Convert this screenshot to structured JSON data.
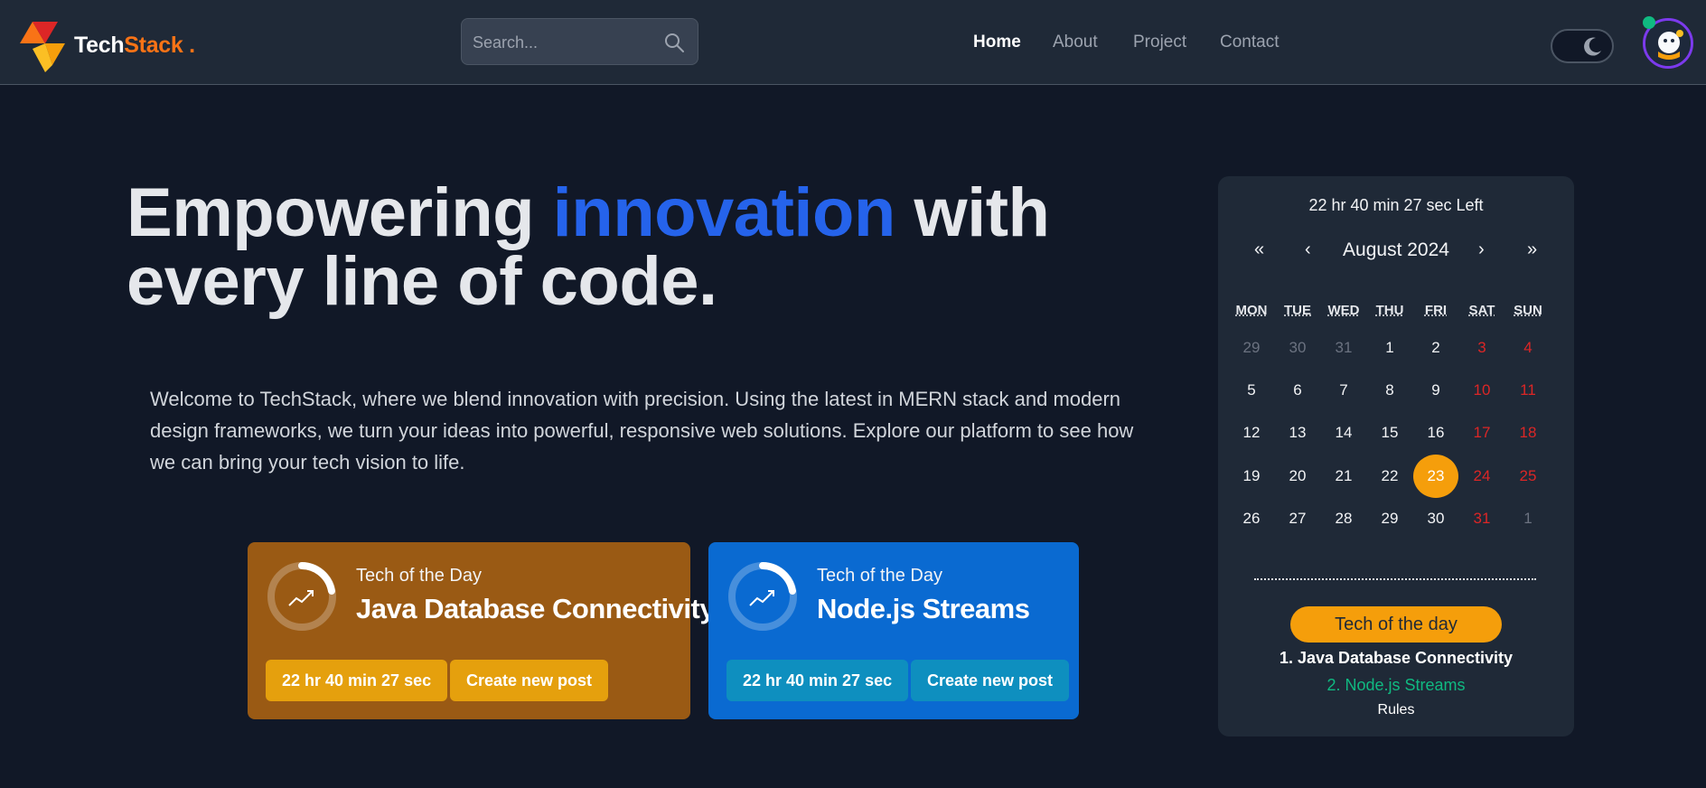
{
  "brand": {
    "name_a": "Tech",
    "name_b": "Stack",
    "name_c": " ."
  },
  "search": {
    "placeholder": "Search..."
  },
  "nav": [
    {
      "label": "Home",
      "active": true
    },
    {
      "label": "About",
      "active": false
    },
    {
      "label": "Project",
      "active": false
    },
    {
      "label": "Contact",
      "active": false
    }
  ],
  "hero": {
    "title_a": "Empowering ",
    "title_highlight": "innovation",
    "title_b": " with every line of code.",
    "text": "Welcome to TechStack, where we blend innovation with precision. Using the latest in MERN stack and modern design frameworks, we turn your ideas into powerful, responsive web solutions. Explore our platform to see how we can bring your tech vision to life."
  },
  "cards": [
    {
      "label": "Tech of the Day",
      "title": "Java Database Connectivity",
      "timer": "22 hr 40 min 27 sec",
      "action": "Create new post",
      "color": "#9a5a14"
    },
    {
      "label": "Tech of the Day",
      "title": "Node.js Streams",
      "timer": "22 hr 40 min 27 sec",
      "action": "Create new post",
      "color": "#0a6ad1"
    }
  ],
  "calendar": {
    "countdown": "22 hr 40 min 27 sec Left",
    "nav_first": "«",
    "nav_prev": "‹",
    "month": "August 2024",
    "nav_next": "›",
    "nav_last": "»",
    "weekdays": [
      "MON",
      "TUE",
      "WED",
      "THU",
      "FRI",
      "SAT",
      "SUN"
    ],
    "weeks": [
      [
        "29",
        "30",
        "31",
        "1",
        "2",
        "3",
        "4"
      ],
      [
        "5",
        "6",
        "7",
        "8",
        "9",
        "10",
        "11"
      ],
      [
        "12",
        "13",
        "14",
        "15",
        "16",
        "17",
        "18"
      ],
      [
        "19",
        "20",
        "21",
        "22",
        "23",
        "24",
        "25"
      ],
      [
        "26",
        "27",
        "28",
        "29",
        "30",
        "31",
        "1"
      ]
    ],
    "selected": "23"
  },
  "tech_of_day": {
    "button": "Tech of the day",
    "item1": "1. Java Database Connectivity",
    "item2": "2. Node.js Streams",
    "rules": "Rules"
  },
  "colors": {
    "background": "#111827",
    "accent_blue": "#2563eb",
    "accent_orange": "#f97316",
    "highlight_amber": "#f59e0b",
    "weekend_red": "#dc2626",
    "success_green": "#10b981"
  }
}
